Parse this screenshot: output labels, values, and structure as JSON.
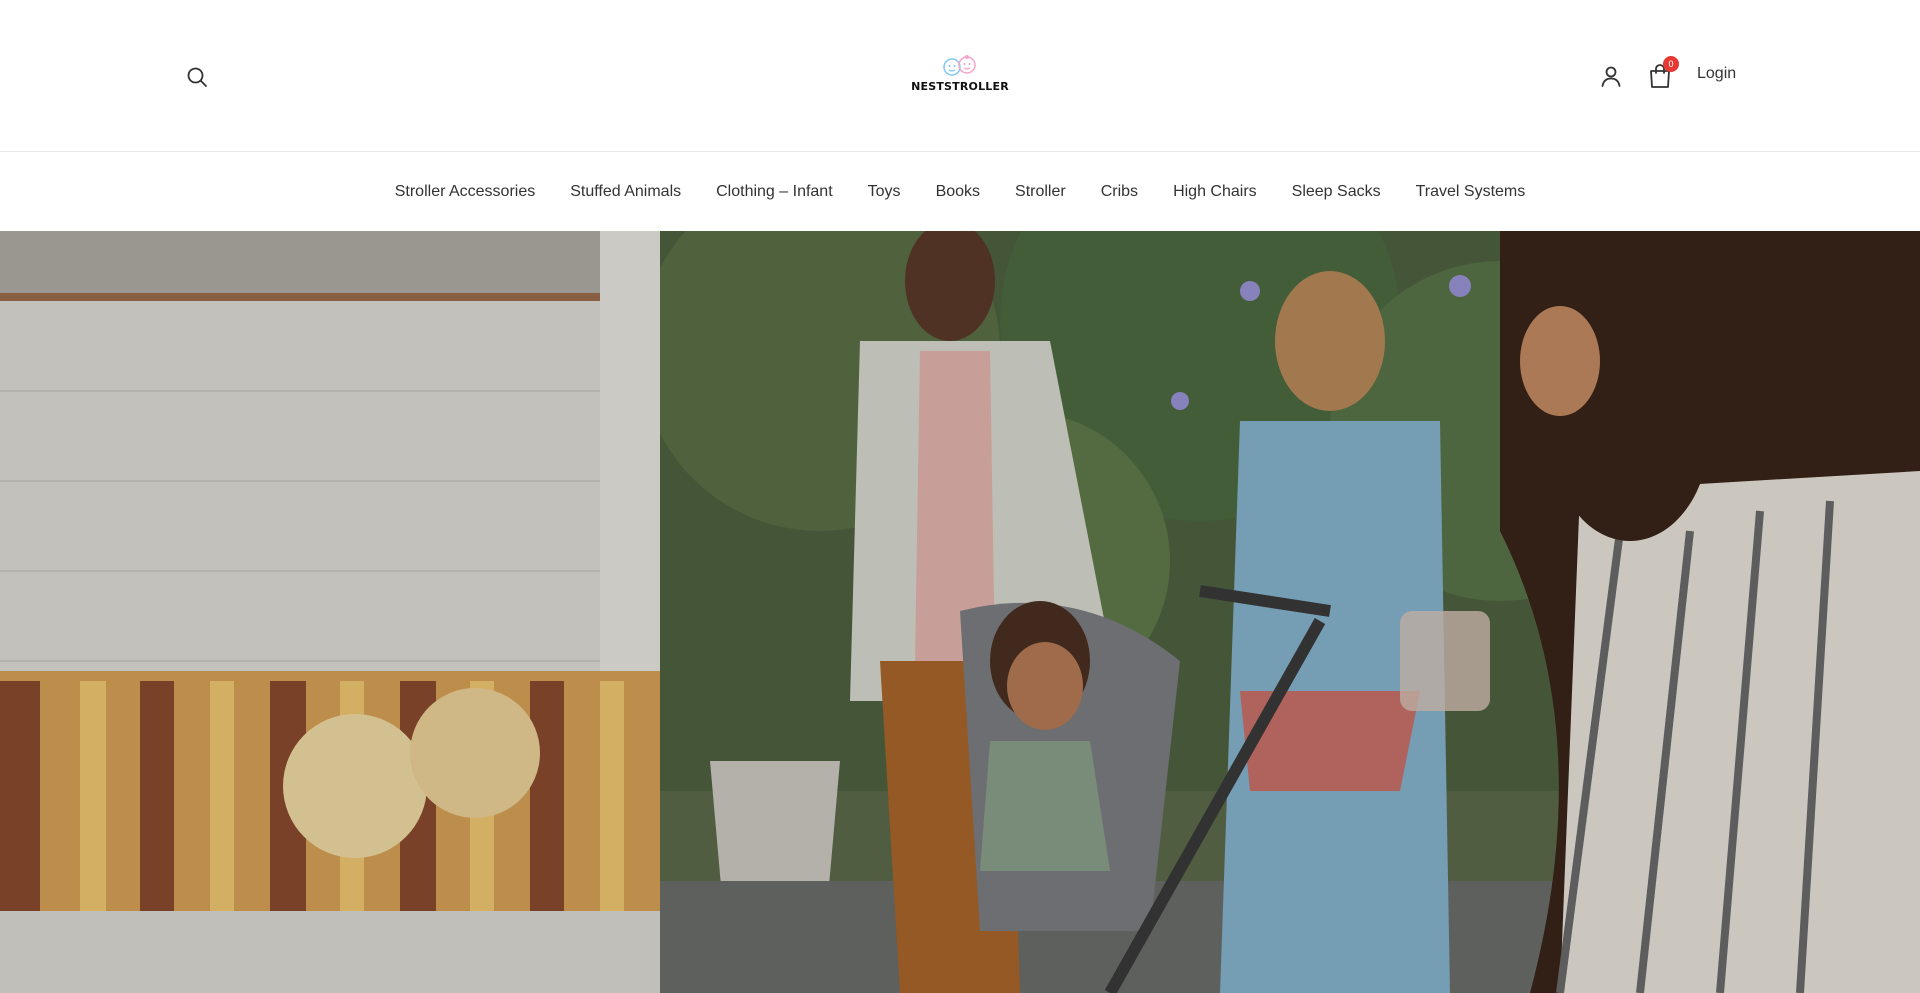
{
  "brand": {
    "name": "NESTSTROLLER"
  },
  "header": {
    "cart_count": "0",
    "login_label": "Login",
    "icons": [
      "search-icon",
      "user-icon",
      "shopping-bag-icon"
    ]
  },
  "nav": {
    "items": [
      {
        "label": "Stroller Accessories"
      },
      {
        "label": "Stuffed Animals"
      },
      {
        "label": "Clothing – Infant"
      },
      {
        "label": "Toys"
      },
      {
        "label": "Books"
      },
      {
        "label": "Stroller"
      },
      {
        "label": "Cribs"
      },
      {
        "label": "High Chairs"
      },
      {
        "label": "Sleep Sacks"
      },
      {
        "label": "Travel Systems"
      }
    ]
  },
  "colors": {
    "badge": "#e53935",
    "text": "#333333",
    "logo_blue": "#7fc8f0",
    "logo_pink": "#f5a3c7"
  }
}
